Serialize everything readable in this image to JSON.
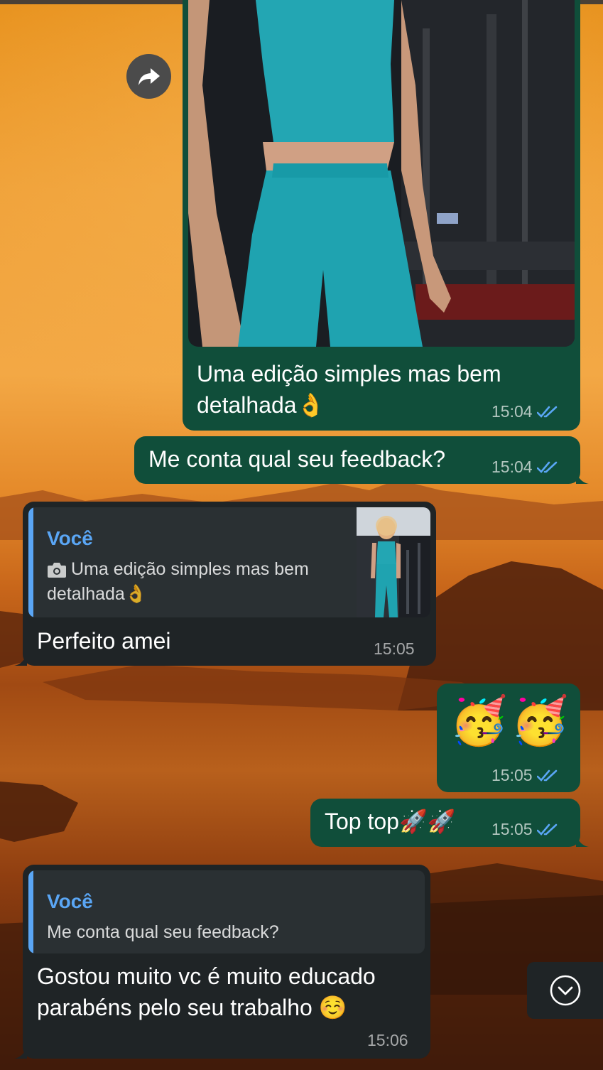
{
  "colors": {
    "outgoing_bubble": "#104e3a",
    "incoming_bubble": "#1f2426",
    "quote_accent": "#5aa6f5",
    "read_tick": "#5aa6f5"
  },
  "icons": {
    "forward": "forward-icon",
    "double_check": "double-check-icon",
    "camera": "camera-icon",
    "scroll_down": "chevron-down-icon"
  },
  "messages": [
    {
      "direction": "outgoing",
      "type": "image",
      "caption_lines": [
        "Uma edição simples mas bem",
        "detalhada👌"
      ],
      "time": "15:04",
      "status": "read"
    },
    {
      "direction": "outgoing",
      "text": "Me conta qual seu feedback?",
      "time": "15:04",
      "status": "read"
    },
    {
      "direction": "incoming",
      "reply_to": {
        "author": "Você",
        "text_lines": [
          "Uma edição simples mas bem",
          "detalhada👌"
        ],
        "has_thumbnail": true
      },
      "text": "Perfeito amei",
      "time": "15:05"
    },
    {
      "direction": "outgoing",
      "text": "🥳🥳",
      "time": "15:05",
      "status": "read"
    },
    {
      "direction": "outgoing",
      "text": "Top top🚀🚀",
      "time": "15:05",
      "status": "read"
    },
    {
      "direction": "incoming",
      "reply_to": {
        "author": "Você",
        "text_lines": [
          "Me conta qual seu feedback?"
        ],
        "has_thumbnail": false
      },
      "text_lines": [
        "Gostou muito vc é muito educado",
        "parabéns pelo seu trabalho ☺️"
      ],
      "time": "15:06"
    }
  ]
}
